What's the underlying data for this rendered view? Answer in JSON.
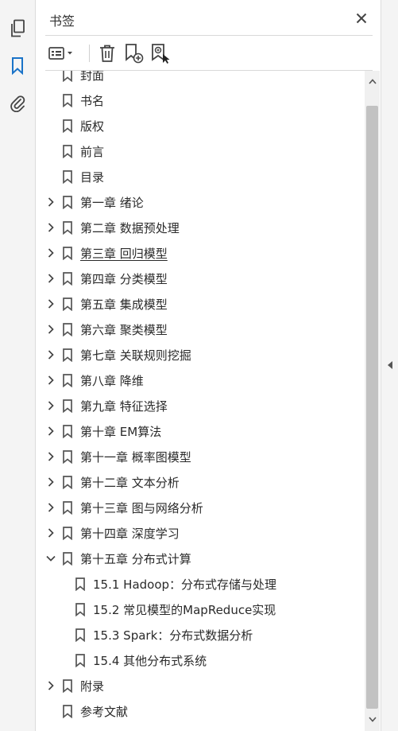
{
  "panel": {
    "title": "书签"
  },
  "icons": {
    "rail": [
      "pages-icon",
      "bookmark-icon",
      "attachment-icon"
    ],
    "toolbar": [
      "options-menu-icon",
      "delete-bookmark-icon",
      "new-bookmark-icon",
      "bookmark-from-selection-icon"
    ]
  },
  "colors": {
    "accent": "#1a73c8",
    "text": "#2a2a2a",
    "panel_bg": "#ffffff",
    "rail_bg": "#f4f4f4",
    "scroll_thumb": "#c2c2c2"
  },
  "bookmarks": [
    {
      "label": "封面",
      "level": 0,
      "expander": "none",
      "partial": true
    },
    {
      "label": "书名",
      "level": 0,
      "expander": "none"
    },
    {
      "label": "版权",
      "level": 0,
      "expander": "none"
    },
    {
      "label": "前言",
      "level": 0,
      "expander": "none"
    },
    {
      "label": "目录",
      "level": 0,
      "expander": "none"
    },
    {
      "label": "第一章  绪论",
      "level": 0,
      "expander": "collapsed"
    },
    {
      "label": "第二章  数据预处理",
      "level": 0,
      "expander": "collapsed"
    },
    {
      "label": "第三章  回归模型",
      "level": 0,
      "expander": "collapsed",
      "hovered": true
    },
    {
      "label": "第四章  分类模型",
      "level": 0,
      "expander": "collapsed"
    },
    {
      "label": "第五章  集成模型",
      "level": 0,
      "expander": "collapsed"
    },
    {
      "label": "第六章  聚类模型",
      "level": 0,
      "expander": "collapsed"
    },
    {
      "label": "第七章  关联规则挖掘",
      "level": 0,
      "expander": "collapsed"
    },
    {
      "label": "第八章  降维",
      "level": 0,
      "expander": "collapsed"
    },
    {
      "label": "第九章  特征选择",
      "level": 0,
      "expander": "collapsed"
    },
    {
      "label": "第十章  EM算法",
      "level": 0,
      "expander": "collapsed"
    },
    {
      "label": "第十一章  概率图模型",
      "level": 0,
      "expander": "collapsed"
    },
    {
      "label": "第十二章  文本分析",
      "level": 0,
      "expander": "collapsed"
    },
    {
      "label": "第十三章  图与网络分析",
      "level": 0,
      "expander": "collapsed"
    },
    {
      "label": "第十四章  深度学习",
      "level": 0,
      "expander": "collapsed"
    },
    {
      "label": "第十五章  分布式计算",
      "level": 0,
      "expander": "expanded"
    },
    {
      "label": "15.1  Hadoop：分布式存储与处理",
      "level": 1,
      "expander": "none"
    },
    {
      "label": "15.2  常见模型的MapReduce实现",
      "level": 1,
      "expander": "none"
    },
    {
      "label": "15.3  Spark：分布式数据分析",
      "level": 1,
      "expander": "none"
    },
    {
      "label": "15.4  其他分布式系统",
      "level": 1,
      "expander": "none"
    },
    {
      "label": "附录",
      "level": 0,
      "expander": "collapsed"
    },
    {
      "label": "参考文献",
      "level": 0,
      "expander": "none"
    }
  ]
}
